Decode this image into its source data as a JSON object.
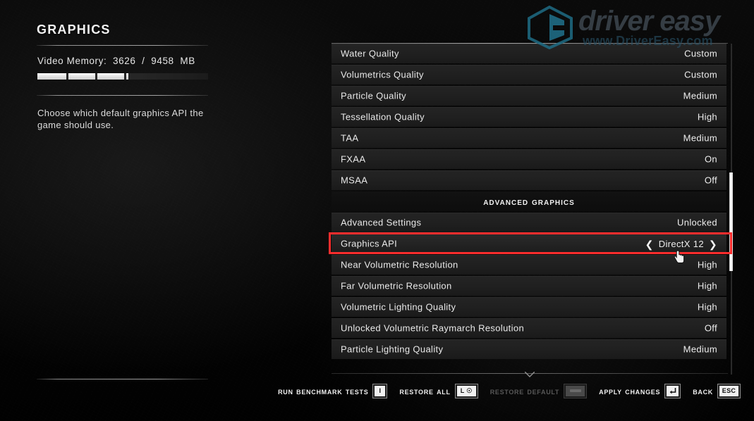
{
  "page": {
    "title": "Graphics",
    "video_memory_label": "Video Memory:  3626  /  9458  MB",
    "video_memory_used_mb": 3626,
    "video_memory_total_mb": 9458,
    "description": "Choose which default graphics API the game should use."
  },
  "settings": {
    "rows": [
      {
        "label": "Water Quality",
        "value": "Custom",
        "type": "value"
      },
      {
        "label": "Volumetrics Quality",
        "value": "Custom",
        "type": "value"
      },
      {
        "label": "Particle Quality",
        "value": "Medium",
        "type": "value"
      },
      {
        "label": "Tessellation Quality",
        "value": "High",
        "type": "value"
      },
      {
        "label": "TAA",
        "value": "Medium",
        "type": "value"
      },
      {
        "label": "FXAA",
        "value": "On",
        "type": "value"
      },
      {
        "label": "MSAA",
        "value": "Off",
        "type": "value"
      },
      {
        "label": "Advanced Graphics",
        "value": "",
        "type": "section"
      },
      {
        "label": "Advanced Settings",
        "value": "Unlocked",
        "type": "value"
      },
      {
        "label": "Graphics API",
        "value": "DirectX 12",
        "type": "stepper",
        "selected": true
      },
      {
        "label": "Near Volumetric Resolution",
        "value": "High",
        "type": "value"
      },
      {
        "label": "Far Volumetric Resolution",
        "value": "High",
        "type": "value"
      },
      {
        "label": "Volumetric Lighting Quality",
        "value": "High",
        "type": "value"
      },
      {
        "label": "Unlocked Volumetric Raymarch Resolution",
        "value": "Off",
        "type": "value"
      },
      {
        "label": "Particle Lighting Quality",
        "value": "Medium",
        "type": "value"
      }
    ],
    "stepper_left_glyph": "❮",
    "stepper_right_glyph": "❯",
    "selection_highlight_color": "#ff2d2d"
  },
  "bottom_bar": {
    "prompts": [
      {
        "label": "Run Benchmark Tests",
        "key": "I",
        "key_type": "text",
        "disabled": false
      },
      {
        "label": "Restore All",
        "key": "L ☉",
        "key_type": "text",
        "disabled": false
      },
      {
        "label": "Restore Default",
        "key": "",
        "key_type": "blank",
        "disabled": true
      },
      {
        "label": "Apply Changes",
        "key": "",
        "key_type": "enter",
        "disabled": false
      },
      {
        "label": "Back",
        "key": "ESC",
        "key_type": "text",
        "disabled": false
      }
    ]
  },
  "watermark": {
    "brand": "driver easy",
    "url": "www.DriverEasy.com"
  }
}
